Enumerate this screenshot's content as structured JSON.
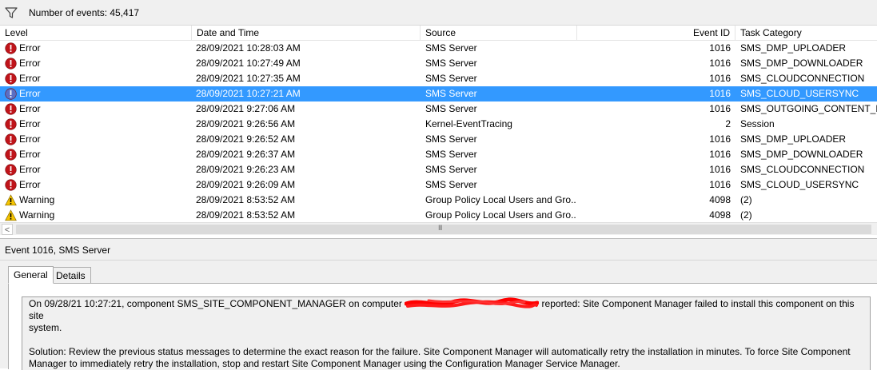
{
  "filter_bar": {
    "icon": "filter-icon",
    "label": "Number of events: 45,417"
  },
  "columns": {
    "level": "Level",
    "date_time": "Date and Time",
    "source": "Source",
    "event_id": "Event ID",
    "task_category": "Task Category"
  },
  "events": [
    {
      "level": "Error",
      "icon": "error-icon",
      "date": "28/09/2021 10:28:03 AM",
      "source": "SMS Server",
      "event_id": "1016",
      "task_category": "SMS_DMP_UPLOADER"
    },
    {
      "level": "Error",
      "icon": "error-icon",
      "date": "28/09/2021 10:27:49 AM",
      "source": "SMS Server",
      "event_id": "1016",
      "task_category": "SMS_DMP_DOWNLOADER"
    },
    {
      "level": "Error",
      "icon": "error-icon",
      "date": "28/09/2021 10:27:35 AM",
      "source": "SMS Server",
      "event_id": "1016",
      "task_category": "SMS_CLOUDCONNECTION"
    },
    {
      "level": "Error",
      "icon": "error-icon",
      "date": "28/09/2021 10:27:21 AM",
      "source": "SMS Server",
      "event_id": "1016",
      "task_category": "SMS_CLOUD_USERSYNC",
      "selected": true
    },
    {
      "level": "Error",
      "icon": "error-icon",
      "date": "28/09/2021 9:27:06 AM",
      "source": "SMS Server",
      "event_id": "1016",
      "task_category": "SMS_OUTGOING_CONTENT_MA"
    },
    {
      "level": "Error",
      "icon": "error-icon",
      "date": "28/09/2021 9:26:56 AM",
      "source": "Kernel-EventTracing",
      "event_id": "2",
      "task_category": "Session"
    },
    {
      "level": "Error",
      "icon": "error-icon",
      "date": "28/09/2021 9:26:52 AM",
      "source": "SMS Server",
      "event_id": "1016",
      "task_category": "SMS_DMP_UPLOADER"
    },
    {
      "level": "Error",
      "icon": "error-icon",
      "date": "28/09/2021 9:26:37 AM",
      "source": "SMS Server",
      "event_id": "1016",
      "task_category": "SMS_DMP_DOWNLOADER"
    },
    {
      "level": "Error",
      "icon": "error-icon",
      "date": "28/09/2021 9:26:23 AM",
      "source": "SMS Server",
      "event_id": "1016",
      "task_category": "SMS_CLOUDCONNECTION"
    },
    {
      "level": "Error",
      "icon": "error-icon",
      "date": "28/09/2021 9:26:09 AM",
      "source": "SMS Server",
      "event_id": "1016",
      "task_category": "SMS_CLOUD_USERSYNC"
    },
    {
      "level": "Warning",
      "icon": "warning-icon",
      "date": "28/09/2021 8:53:52 AM",
      "source": "Group Policy Local Users and Gro...",
      "event_id": "4098",
      "task_category": "(2)"
    },
    {
      "level": "Warning",
      "icon": "warning-icon",
      "date": "28/09/2021 8:53:52 AM",
      "source": "Group Policy Local Users and Gro...",
      "event_id": "4098",
      "task_category": "(2)"
    }
  ],
  "scrollbar": {
    "left_arrow": "<",
    "grip": "III"
  },
  "detail": {
    "title": "Event 1016, SMS Server",
    "tabs": [
      {
        "label": "General",
        "active": true
      },
      {
        "label": "Details",
        "active": false
      }
    ],
    "message": {
      "line1_before": "On 09/28/21 10:27:21, component SMS_SITE_COMPONENT_MANAGER on computer ",
      "line1_after": " reported:  Site Component Manager failed to install this component on this site",
      "line2": "system.",
      "line3": "Solution: Review the previous status messages to determine the exact reason for the failure. Site Component Manager will automatically retry the installation in  minutes. To force Site Component",
      "line4": "Manager to immediately retry the installation, stop and restart Site Component Manager using the Configuration Manager Service Manager."
    }
  },
  "colors": {
    "selection": "#3399ff",
    "error": "#c0141a",
    "warning": "#f5c400",
    "redaction": "#ff0000",
    "panel": "#f0f0f0"
  }
}
